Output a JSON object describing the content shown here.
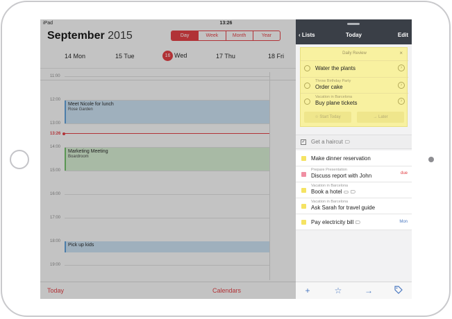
{
  "status_bar": {
    "device": "iPad",
    "time": "13:26"
  },
  "calendar": {
    "month": "September",
    "year": "2015",
    "views": [
      "Day",
      "Week",
      "Month",
      "Year"
    ],
    "selected_view": "Day",
    "days": [
      {
        "label": "14 Mon"
      },
      {
        "label": "15 Tue"
      },
      {
        "num": "16",
        "label": "Wed"
      },
      {
        "label": "17 Thu"
      },
      {
        "label": "18 Fri"
      }
    ],
    "hours": [
      "11:00",
      "12:00",
      "13:00",
      "14:00",
      "15:00",
      "16:00",
      "17:00",
      "18:00",
      "19:00"
    ],
    "now_label": "13:26",
    "events": [
      {
        "title": "Meet Nicole for lunch",
        "location": "Rose Garden"
      },
      {
        "title": "Marketing Meeting",
        "location": "Boardroom"
      },
      {
        "title": "Pick up kids",
        "location": ""
      }
    ],
    "toolbar": {
      "today": "Today",
      "calendars": "Calendars"
    },
    "colors": {
      "accent": "#e0393e"
    }
  },
  "tasks_pane": {
    "header": {
      "back": "Lists",
      "title": "Today",
      "edit": "Edit"
    },
    "daily_review": {
      "title": "Daily Review",
      "close": "×",
      "items": [
        {
          "project": "",
          "text": "Water the plants"
        },
        {
          "project": "Throw Birthday Party",
          "text": "Order cake"
        },
        {
          "project": "Vacation in Barcelona",
          "text": "Buy plane tickets"
        }
      ],
      "start_label": "Start Today",
      "later_label": "Later"
    },
    "completed": {
      "text": "Get a haircut",
      "check": "✓"
    },
    "tasks": [
      {
        "project": "",
        "text": "Make dinner reservation",
        "due": "",
        "color": "#f5e363"
      },
      {
        "project": "Prepare Presentation",
        "text": "Discuss report with John",
        "due": "due",
        "color": "#f08fa3",
        "due_color": "#e0393e"
      },
      {
        "project": "Vacation in Barcelona",
        "text": "Book a hotel",
        "due": "",
        "color": "#f5e363"
      },
      {
        "project": "Vacation in Barcelona",
        "text": "Ask Sarah for travel guide",
        "due": "",
        "color": "#f5e363"
      },
      {
        "project": "",
        "text": "Pay electricity bill",
        "due": "Mon",
        "color": "#f5e363",
        "due_color": "#4a78c0"
      }
    ],
    "toolbar_icons": [
      "plus-icon",
      "star-icon",
      "arrow-right-icon",
      "tag-icon"
    ]
  }
}
